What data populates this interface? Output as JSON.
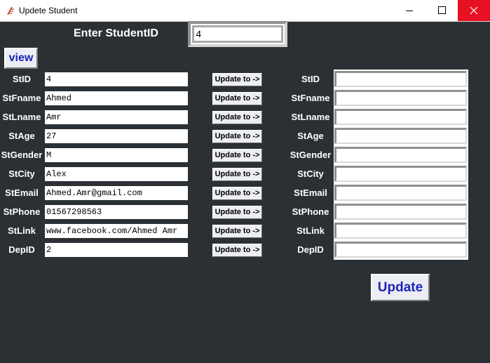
{
  "window": {
    "title": "Updete Student",
    "icon": "feather-app-icon",
    "controls": [
      "minimize-icon",
      "maximize-icon",
      "close-icon"
    ],
    "close_color": "#e81123"
  },
  "colors": {
    "background": "#2b3034",
    "button_text": "#1a25b5",
    "label_text": "#ffffff"
  },
  "lookup": {
    "label": "Enter StudentID",
    "value": "4",
    "view_label": "view"
  },
  "fields": [
    {
      "label": "StID",
      "value": "4",
      "update_label": "Update to ->",
      "new_value": ""
    },
    {
      "label": "StFname",
      "value": "Ahmed",
      "update_label": "Update to ->",
      "new_value": ""
    },
    {
      "label": "StLname",
      "value": "Amr",
      "update_label": "Update to ->",
      "new_value": ""
    },
    {
      "label": "StAge",
      "value": "27",
      "update_label": "Update to ->",
      "new_value": ""
    },
    {
      "label": "StGender",
      "value": "M",
      "update_label": "Update to ->",
      "new_value": ""
    },
    {
      "label": "StCity",
      "value": "Alex",
      "update_label": "Update to ->",
      "new_value": ""
    },
    {
      "label": "StEmail",
      "value": "Ahmed.Amr@gmail.com",
      "update_label": "Update to ->",
      "new_value": ""
    },
    {
      "label": "StPhone",
      "value": "01567298563",
      "update_label": "Update to ->",
      "new_value": ""
    },
    {
      "label": "StLink",
      "value": "www.facebook.com/Ahmed Amr",
      "update_label": "Update to ->",
      "new_value": ""
    },
    {
      "label": "DepID",
      "value": "2",
      "update_label": "Update to ->",
      "new_value": ""
    }
  ],
  "actions": {
    "update_label": "Update"
  }
}
